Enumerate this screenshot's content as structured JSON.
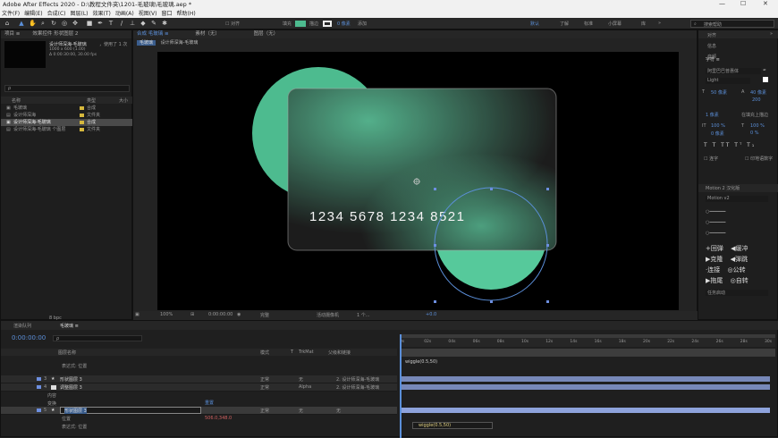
{
  "app": {
    "title": "Adobe After Effects 2020 - D:\\教程文件夹\\1201-毛玻璃\\毛玻璃.aep *",
    "win_min": "—",
    "win_max": "☐",
    "win_close": "✕"
  },
  "menu": [
    "文件(F)",
    "编辑(E)",
    "合成(C)",
    "图层(L)",
    "效果(T)",
    "动画(A)",
    "视图(V)",
    "窗口",
    "帮助(H)"
  ],
  "toolbar": {
    "align": "对齐",
    "fill": "填充",
    "stroke": "描边",
    "stroke_px": "0 像素",
    "add": "添加",
    "default": "默认",
    "learn": "了解",
    "standard": "标准",
    "small_screen": "小屏幕",
    "library": "库",
    "search_placeholder": "搜索帮助"
  },
  "project": {
    "tab": "项目 ≡",
    "effect_tab": "效果控件 形状图层 2",
    "selected_name": "设计师深海-毛玻璃",
    "used_count": "，使用了 1 次",
    "meta1": "1000 x 600 (1.00)",
    "meta2": "Δ 0:00:30:00, 30.00 fps",
    "search_placeholder": "ρ",
    "col_name": "名称",
    "col_type": "类型",
    "col_size": "大小",
    "items": [
      {
        "name": "毛玻璃",
        "type": "合成",
        "color": "#d6b83d"
      },
      {
        "name": "设计师深海",
        "type": "文件夹",
        "color": "#d6b83d"
      },
      {
        "name": "设计师深海-毛玻璃",
        "type": "合成",
        "color": "#d6b83d"
      },
      {
        "name": "设计师深海-毛玻璃 个图层",
        "type": "文件夹",
        "color": "#d6b83d"
      }
    ],
    "bpc": "8 bpc"
  },
  "comp": {
    "tab_lock": "🔒",
    "tab": "合成 毛玻璃 ≡",
    "footage_tab": "素材（无）",
    "layer_tab": "图层（无）",
    "crumb1": "毛玻璃",
    "crumb2": "设计师深海-毛玻璃",
    "card_number": "1234  5678  1234  8521",
    "zoom": "100%",
    "timecode": "0:00:00:00",
    "quality": "完整",
    "camera": "活动摄像机",
    "views": "1 个...",
    "exposure": "+0.0"
  },
  "right": {
    "items": [
      "对齐",
      "信息",
      "音频"
    ],
    "char_tab": "字符 ≡",
    "font": "阿里巴巴普惠体",
    "style": "Light",
    "size": "50 像素",
    "leading": "40 像素",
    "tracking": "200",
    "stroke_width": "1 像素",
    "stroke_mode": "在填充上描边",
    "scale_v": "100 %",
    "scale_h": "100 %",
    "baseline": "0 像素",
    "tsume": "0 %",
    "ligature": "连字",
    "hindi": "印地语数字",
    "motion_tab": "Motion 2 汉化版",
    "motion_ver": "Motion v2",
    "buttons": [
      [
        "+回弹",
        "◀缓冲"
      ],
      [
        "▶克隆",
        "◀弹跳"
      ],
      [
        "·连接",
        "◎公转"
      ],
      [
        "▶拖尾",
        "◎自转"
      ]
    ],
    "task": "任务启动"
  },
  "timeline": {
    "render_tab": "渲染队列",
    "comp_tab": "毛玻璃 ≡",
    "timecode": "0:00:00:00",
    "search_placeholder": "ρ",
    "h_name": "图层名称",
    "h_mode": "模式",
    "h_t": "T",
    "h_trk": "TrkMat",
    "h_parent": "父级和链接",
    "expr_label": "表达式: 位置",
    "layers": [
      {
        "num": "3",
        "name": "形状图层 3",
        "mode": "正常",
        "trk": "无",
        "parent": "2. 设计师深海-毛玻璃"
      },
      {
        "num": "4",
        "name": "调整图层 3",
        "mode": "正常",
        "trk": "Alpha",
        "parent": "2. 设计师深海-毛玻璃"
      },
      {
        "num": "5",
        "name": "形状图层 3",
        "mode": "正常",
        "trk": "无",
        "parent": "无"
      }
    ],
    "contents": "内容",
    "transform": "变换",
    "reset": "重置",
    "position": "位置",
    "pos_value": "506.0,348.0",
    "expr2": "表达式: 位置",
    "ruler": [
      "0s",
      "02s",
      "04s",
      "06s",
      "08s",
      "10s",
      "12s",
      "14s",
      "16s",
      "18s",
      "20s",
      "22s",
      "24s",
      "26s",
      "28s",
      "30s"
    ],
    "wiggle1": "wiggle(0.5,50)",
    "wiggle2": "wiggle(0.5,50)"
  },
  "colors": {
    "accent": "#5b8fd9",
    "green": "#4dbb8f",
    "card_green": "#56c99b"
  }
}
